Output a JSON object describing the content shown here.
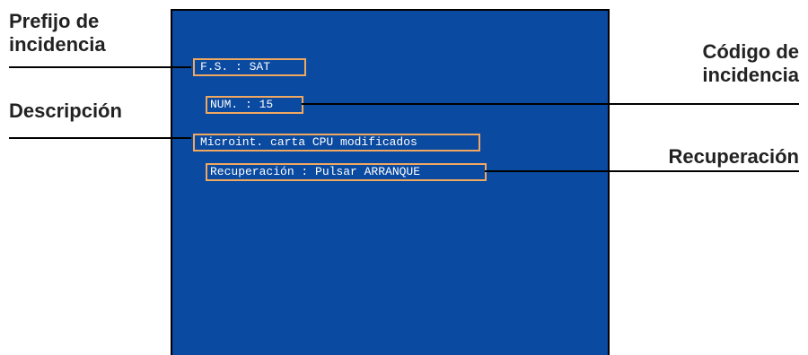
{
  "callouts": {
    "prefix": {
      "line1": "Prefijo de",
      "line2": "incidencia"
    },
    "description": "Descripción",
    "code": {
      "line1": "Código de",
      "line2": "incidencia"
    },
    "recovery": "Recuperación"
  },
  "screen": {
    "prefix_field": "F.S. : SAT",
    "code_field": "NUM. : 15",
    "description_field": "Microint. carta CPU modificados",
    "recovery_field": "Recuperación : Pulsar ARRANQUE"
  },
  "colors": {
    "screen_background": "#0a4aa0",
    "field_border": "#f0a860",
    "field_text": "#ffffff",
    "callout_text": "#222222"
  }
}
